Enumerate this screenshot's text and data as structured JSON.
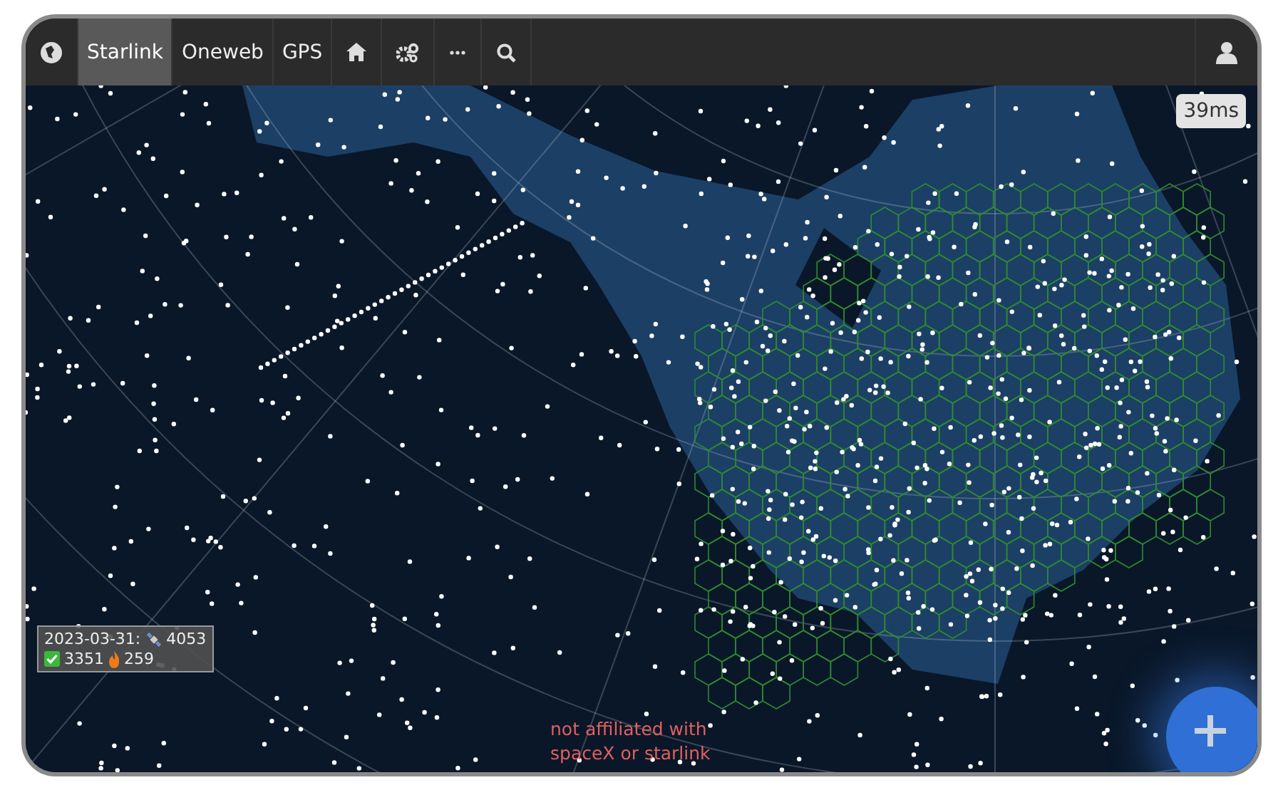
{
  "nav": {
    "tabs": [
      {
        "label": "Starlink",
        "selected": true
      },
      {
        "label": "Oneweb",
        "selected": false
      },
      {
        "label": "GPS",
        "selected": false
      }
    ]
  },
  "latency": "39ms",
  "stats": {
    "date": "2023-03-31:",
    "total": "4053",
    "active": "3351",
    "decayed": "259"
  },
  "disclaimer": "not affiliated with spaceX or starlink"
}
